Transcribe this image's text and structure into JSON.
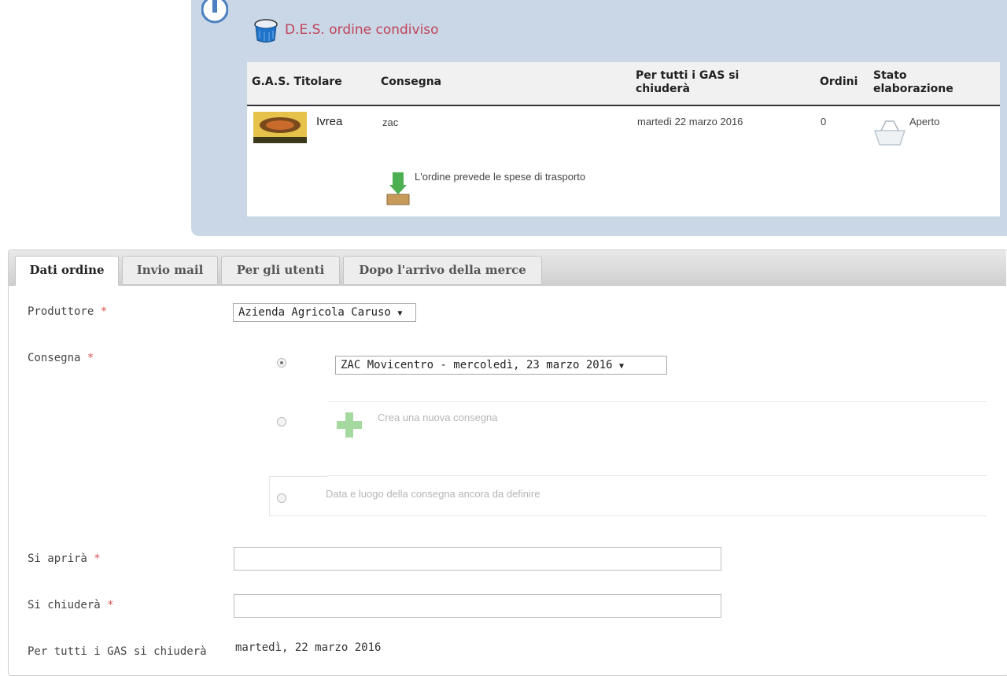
{
  "des": {
    "title": "D.E.S. ordine condiviso",
    "columns": [
      "G.A.S. Titolare",
      "Consegna",
      "Per tutti i GAS si chiuderà",
      "Ordini",
      "Stato elaborazione"
    ],
    "row": {
      "gas": "Ivrea",
      "consegna": "zac",
      "chiusura": "martedì 22 marzo 2016",
      "ordini": "0",
      "stato": "Aperto"
    },
    "note": "L'ordine prevede le spese di trasporto"
  },
  "tabs": [
    "Dati ordine",
    "Invio mail",
    "Per gli utenti",
    "Dopo l'arrivo della merce"
  ],
  "form": {
    "produttore_label": "Produttore",
    "produttore_value": "Azienda Agricola Caruso",
    "consegna_label": "Consegna",
    "consegna_value": "ZAC Movicentro - mercoledì, 23 marzo 2016",
    "nuova_consegna": "Crea una nuova consegna",
    "da_definire": "Data e luogo della consegna ancora da definire",
    "apre_label": "Si aprirà",
    "apre_value": "",
    "chiude_label": "Si chiuderà",
    "chiude_value": "",
    "tutti_label": "Per tutti i GAS si chiuderà",
    "tutti_value": "martedì, 22 marzo 2016",
    "required_mark": "*"
  },
  "colors": {
    "des_bg": "#c9d7e7",
    "title": "#c1445a",
    "required": "#d9534f"
  }
}
